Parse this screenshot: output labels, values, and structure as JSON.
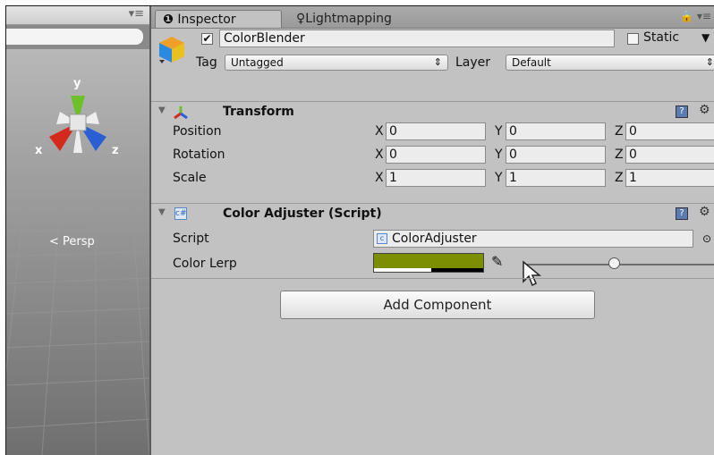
{
  "inspector": {
    "tabs": {
      "inspector": "Inspector",
      "lightmapping": "Lightmapping"
    },
    "object": {
      "active": true,
      "name": "ColorBlender",
      "static_label": "Static",
      "tag_label": "Tag",
      "tag_value": "Untagged",
      "layer_label": "Layer",
      "layer_value": "Default"
    },
    "transform": {
      "title": "Transform",
      "rows": [
        {
          "label": "Position",
          "x": "0",
          "y": "0",
          "z": "0"
        },
        {
          "label": "Rotation",
          "x": "0",
          "y": "0",
          "z": "0"
        },
        {
          "label": "Scale",
          "x": "1",
          "y": "1",
          "z": "1"
        }
      ],
      "axis": {
        "x": "X",
        "y": "Y",
        "z": "Z"
      }
    },
    "script_component": {
      "title": "Color Adjuster (Script)",
      "script_label": "Script",
      "script_value": "ColorAdjuster",
      "color_lerp_label": "Color Lerp",
      "color_value": "#7B8F00",
      "slider_fraction": 0.45
    },
    "add_component": "Add Component"
  },
  "scene": {
    "persp_label": "Persp",
    "gizmo": {
      "y": "y",
      "x": "x",
      "z": "z"
    }
  },
  "colors": {
    "panel_bg": "#C2C2C2",
    "gizmo_y": "#6ec02a",
    "gizmo_x": "#d42a1e",
    "gizmo_z": "#2a5fd4"
  }
}
